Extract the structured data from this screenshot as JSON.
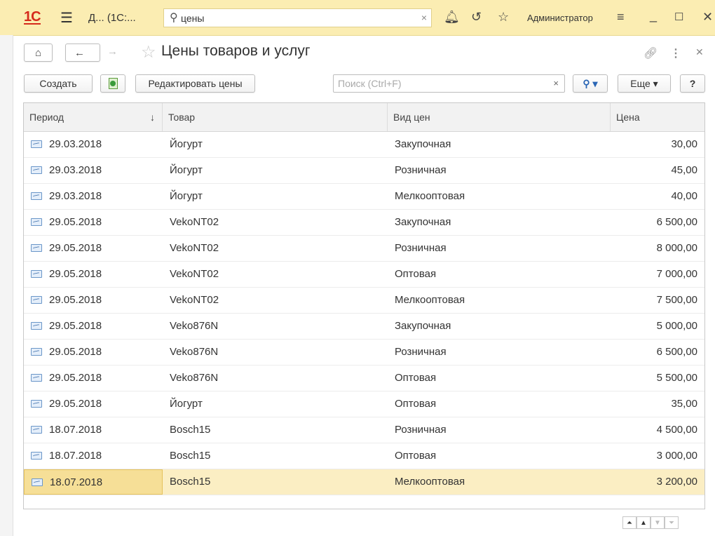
{
  "titlebar": {
    "logo": "1С",
    "menu_icon": "hamburger-icon",
    "doc_title": "Д... (1С:...",
    "search_value": "цены",
    "user": "Администратор"
  },
  "form": {
    "title": "Цены товаров и услуг"
  },
  "toolbar": {
    "create_label": "Создать",
    "edit_prices_label": "Редактировать цены",
    "search_placeholder": "Поиск (Ctrl+F)",
    "clear_label": "×",
    "more_label": "Еще ▾",
    "help_label": "?"
  },
  "table": {
    "columns": [
      "Период",
      "Товар",
      "Вид цен",
      "Цена"
    ],
    "sort_indicator": "↓",
    "rows": [
      {
        "period": "29.03.2018",
        "goods": "Йогурт",
        "kind": "Закупочная",
        "price": "30,00"
      },
      {
        "period": "29.03.2018",
        "goods": "Йогурт",
        "kind": "Розничная",
        "price": "45,00"
      },
      {
        "period": "29.03.2018",
        "goods": "Йогурт",
        "kind": "Мелкооптовая",
        "price": "40,00"
      },
      {
        "period": "29.05.2018",
        "goods": "VekoNT02",
        "kind": "Закупочная",
        "price": "6 500,00"
      },
      {
        "period": "29.05.2018",
        "goods": "VekoNT02",
        "kind": "Розничная",
        "price": "8 000,00"
      },
      {
        "period": "29.05.2018",
        "goods": "VekoNT02",
        "kind": "Оптовая",
        "price": "7 000,00"
      },
      {
        "period": "29.05.2018",
        "goods": "VekoNT02",
        "kind": "Мелкооптовая",
        "price": "7 500,00"
      },
      {
        "period": "29.05.2018",
        "goods": "Veko876N",
        "kind": "Закупочная",
        "price": "5 000,00"
      },
      {
        "period": "29.05.2018",
        "goods": "Veko876N",
        "kind": "Розничная",
        "price": "6 500,00"
      },
      {
        "period": "29.05.2018",
        "goods": "Veko876N",
        "kind": "Оптовая",
        "price": "5 500,00"
      },
      {
        "period": "29.05.2018",
        "goods": "Йогурт",
        "kind": "Оптовая",
        "price": "35,00"
      },
      {
        "period": "18.07.2018",
        "goods": "Bosch15",
        "kind": "Розничная",
        "price": "4 500,00"
      },
      {
        "period": "18.07.2018",
        "goods": "Bosch15",
        "kind": "Оптовая",
        "price": "3 000,00"
      },
      {
        "period": "18.07.2018",
        "goods": "Bosch15",
        "kind": "Мелкооптовая",
        "price": "3 200,00",
        "selected": true
      }
    ]
  },
  "colors": {
    "titlebar_bg": "#fbedb2",
    "selected_row": "#fbeec3",
    "selected_cell": "#f6df97",
    "logo_red": "#d52a1c"
  }
}
